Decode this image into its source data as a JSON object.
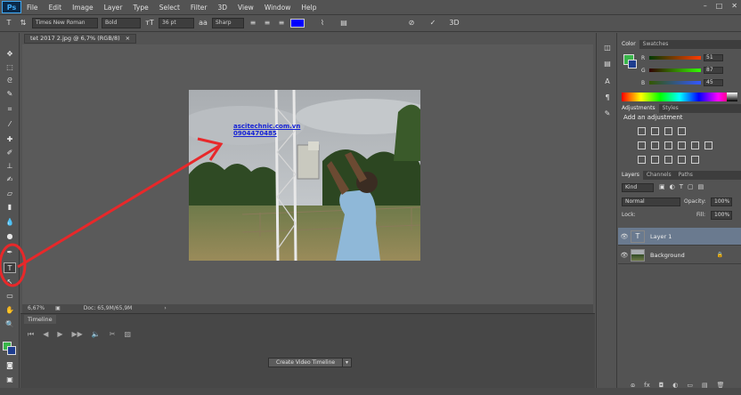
{
  "app": {
    "logo": "Ps"
  },
  "menu": [
    "File",
    "Edit",
    "Image",
    "Layer",
    "Type",
    "Select",
    "Filter",
    "3D",
    "View",
    "Window",
    "Help"
  ],
  "window_controls": [
    "–",
    "□",
    "✕"
  ],
  "options": {
    "font_family": "Times New Roman",
    "font_style": "Bold",
    "font_size": "36 pt",
    "anti_alias": "Sharp",
    "text_color": "#0000ff"
  },
  "document": {
    "tab_title": "tet 2017 2.jpg @ 6,7% (RGB/8)",
    "tab_close": "×",
    "zoom": "6,67%",
    "doc_size": "Doc: 65,9M/65,9M",
    "photo_text_line1": "ascitechnic.com.vn",
    "photo_text_line2": "0904470485"
  },
  "timeline": {
    "tab_label": "Timeline",
    "create_button": "Create Video Timeline",
    "dropdown_arrow": "▾"
  },
  "color_panel": {
    "tabs": [
      "Color",
      "Swatches"
    ],
    "sliders": [
      {
        "letter": "R",
        "value": "51",
        "track": "linear-gradient(to right,#003b00,#ff3b00)"
      },
      {
        "letter": "G",
        "value": "87",
        "track": "linear-gradient(to right,#330000,#33ff00)"
      },
      {
        "letter": "B",
        "value": "45",
        "track": "linear-gradient(to right,#335700,#3357ff)"
      }
    ],
    "fg": "#39b54a"
  },
  "adjustments_panel": {
    "tabs": [
      "Adjustments",
      "Styles"
    ],
    "title": "Add an adjustment"
  },
  "layers_panel": {
    "tabs": [
      "Layers",
      "Channels",
      "Paths"
    ],
    "kind": "Kind",
    "blend_mode": "Normal",
    "opacity_label": "Opacity:",
    "opacity": "100%",
    "lock_label": "Lock:",
    "fill_label": "Fill:",
    "fill": "100%",
    "layers": [
      {
        "name": "Layer 1",
        "thumb": "T",
        "selected": true
      },
      {
        "name": "Background",
        "thumb": "",
        "selected": false,
        "locked": "🔒"
      }
    ],
    "bottom_icons": [
      "ɷ",
      "fx",
      "◘",
      "◐",
      "▭",
      "▤",
      "🗑"
    ]
  }
}
